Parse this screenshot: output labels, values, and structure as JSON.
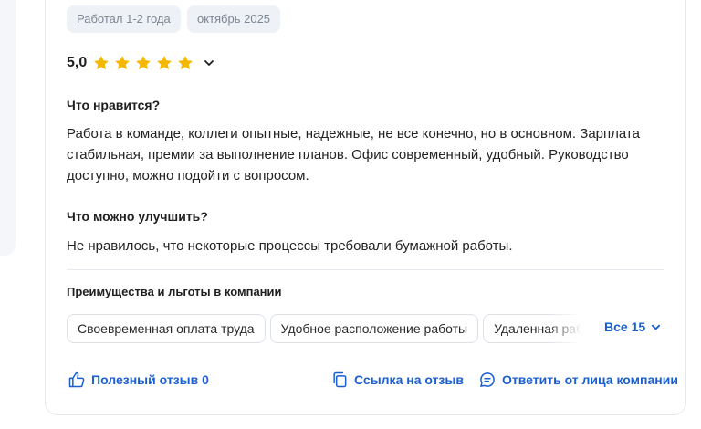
{
  "review": {
    "tags": [
      "Работал 1-2 года",
      "октябрь 2025"
    ],
    "rating_value": "5,0",
    "stars": 5,
    "star_color": "#f5b800",
    "likes_title": "Что нравится?",
    "likes_text": "Работа в команде, коллеги опытные, надежные, не все конечно, но в основном. Зарплата стабильная, премии за выполнение планов. Офис современный, удобный. Руководство доступно, можно подойти с вопросом.",
    "improve_title": "Что можно улучшить?",
    "improve_text": "Не нравилось, что некоторые процессы требовали бумажной работы.",
    "benefits_title": "Преимущества и льготы в компании",
    "benefits": [
      "Своевременная оплата труда",
      "Удобное расположение работы",
      "Удаленная работа"
    ],
    "benefits_all_label": "Все 15",
    "helpful_label": "Полезный отзыв 0",
    "link_label": "Ссылка на отзыв",
    "reply_label": "Ответить от лица компании"
  },
  "colors": {
    "accent": "#1a5fd1",
    "chip_bg": "#eef1f5",
    "chip_text": "#7b8694"
  },
  "icons": [
    "star-icon",
    "chevron-down-icon",
    "thumbs-up-icon",
    "copy-link-icon",
    "comment-icon"
  ]
}
